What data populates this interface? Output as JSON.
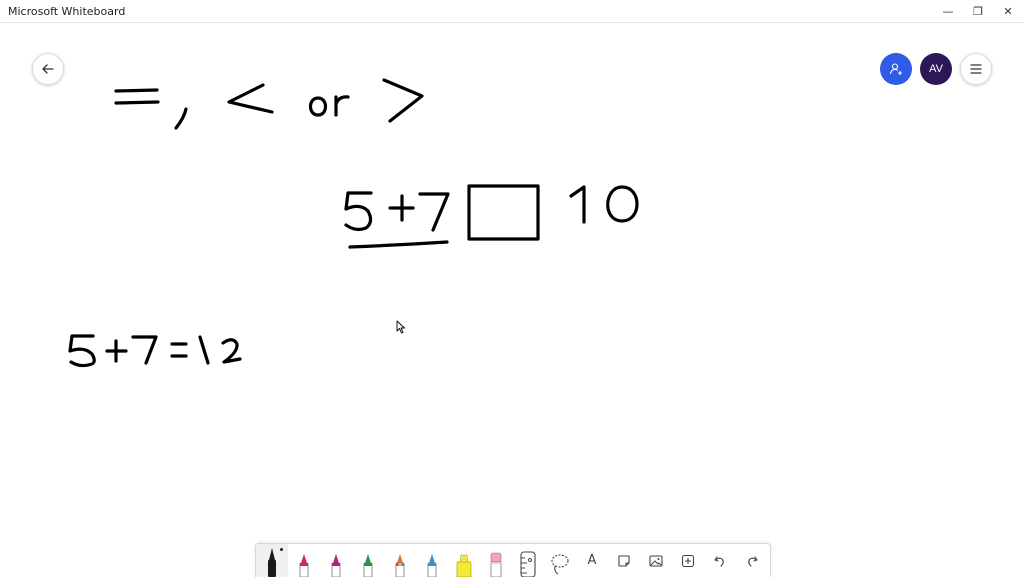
{
  "window": {
    "title": "Microsoft Whiteboard",
    "minimize_glyph": "—",
    "maximize_glyph": "❐",
    "close_glyph": "✕"
  },
  "header": {
    "avatar_initials": "AV",
    "share_color": "#2f5be7",
    "avatar_color": "#2c1757"
  },
  "canvas": {
    "ink_color": "#000000",
    "handwritten_text": [
      "=, < or >",
      "5+7",
      "10",
      "5+7 = 12"
    ]
  },
  "toolbar": {
    "tools": [
      {
        "name": "black-pen",
        "color": "#1a1a1a",
        "active": true
      },
      {
        "name": "red-pen",
        "color": "#e0214b"
      },
      {
        "name": "magenta-pen",
        "color": "#c2187a"
      },
      {
        "name": "green-pen",
        "color": "#1f9a4a"
      },
      {
        "name": "rainbow-pen",
        "color": "#e8742b"
      },
      {
        "name": "galaxy-pen",
        "color": "#3b8fd1"
      },
      {
        "name": "highlighter",
        "color": "#f5e83a"
      },
      {
        "name": "eraser",
        "color": "#f2a3c0"
      },
      {
        "name": "ruler",
        "icon": "ruler-icon"
      },
      {
        "name": "lasso",
        "icon": "lasso-icon"
      },
      {
        "name": "text",
        "icon": "text-icon"
      },
      {
        "name": "note",
        "icon": "note-icon"
      },
      {
        "name": "image",
        "icon": "image-icon"
      },
      {
        "name": "add",
        "icon": "plus-icon"
      },
      {
        "name": "undo",
        "icon": "undo-icon"
      },
      {
        "name": "redo",
        "icon": "redo-icon"
      }
    ],
    "text_tool_label": "A"
  }
}
